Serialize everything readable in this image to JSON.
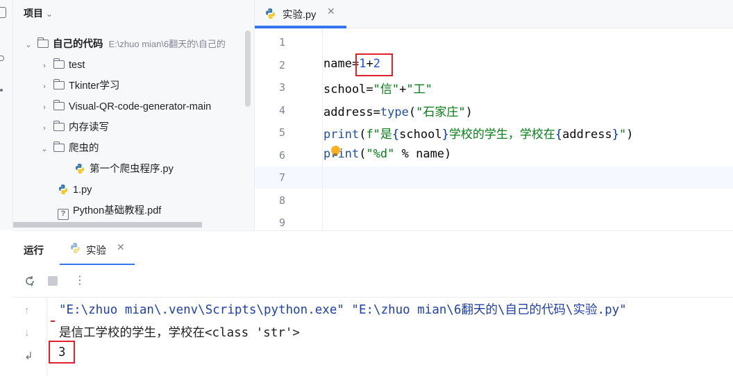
{
  "project": {
    "header": "项目",
    "root": {
      "label": "自己的代码",
      "path": "E:\\zhuo mian\\6翻天的\\自己的"
    },
    "items": [
      {
        "label": "test",
        "kind": "folder"
      },
      {
        "label": "Tkinter学习",
        "kind": "folder"
      },
      {
        "label": "Visual-QR-code-generator-main",
        "kind": "folder"
      },
      {
        "label": "内存读写",
        "kind": "folder"
      },
      {
        "label": "爬虫的",
        "kind": "folder-open"
      },
      {
        "label": "第一个爬虫程序.py",
        "kind": "py"
      },
      {
        "label": "1.py",
        "kind": "py"
      },
      {
        "label": "Python基础教程.pdf",
        "kind": "pdf"
      }
    ]
  },
  "editor": {
    "tab_label": "实验.py",
    "line_numbers": [
      "1",
      "2",
      "3",
      "4",
      "5",
      "6",
      "7",
      "8",
      "9"
    ],
    "code": {
      "l2a": "name=",
      "l2b": "1",
      "l2c": "+",
      "l2d": "2",
      "l3a": "school=",
      "l3b": "\"信\"",
      "l3c": "+",
      "l3d": "\"工\"",
      "l4a": "address=",
      "l4b": "type",
      "l4c": "(",
      "l4d": "\"石家庄\"",
      "l4e": ")",
      "l5a": "print",
      "l5b": "(",
      "l5c": "f\"是",
      "l5d": "{",
      "l5e": "school",
      "l5f": "}",
      "l5g": "学校的学生，学校在",
      "l5h": "{",
      "l5i": "address",
      "l5j": "}",
      "l5k": "\"",
      "l5l": ")",
      "l6a": "print",
      "l6b": "(",
      "l6c": "\"%d\"",
      "l6d": " % name)"
    }
  },
  "run": {
    "title": "运行",
    "tab_label": "实验",
    "output": [
      "\"E:\\zhuo mian\\.venv\\Scripts\\python.exe\" \"E:\\zhuo mian\\6翻天的\\自己的代码\\实验.py\"",
      "是信工学校的学生，学校在<class 'str'>",
      "3"
    ]
  },
  "colors": {
    "accent": "#3574f0",
    "annotation": "#e0212a"
  }
}
